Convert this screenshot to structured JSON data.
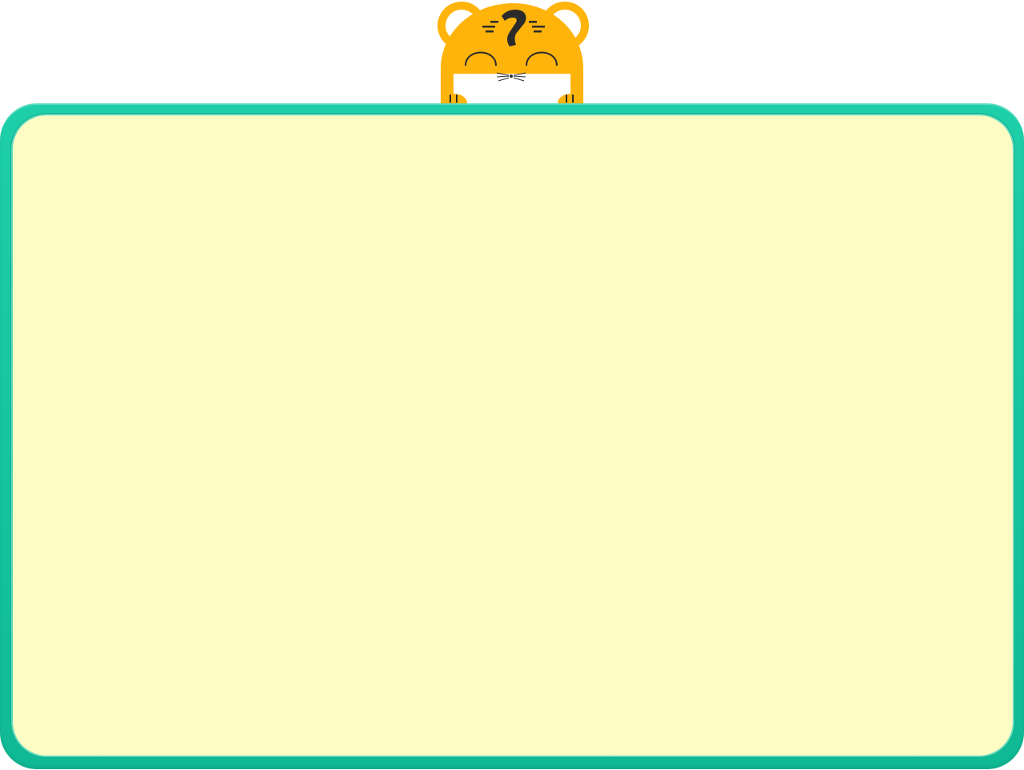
{
  "frame": {
    "border_color": "#14c49e",
    "fill_color": "#fcfcc4"
  },
  "mascot": {
    "kind": "tiger-head",
    "fur_color": "#ffb40b",
    "muzzle_color": "#ffffff",
    "stripe_color": "#2b2b2b"
  }
}
